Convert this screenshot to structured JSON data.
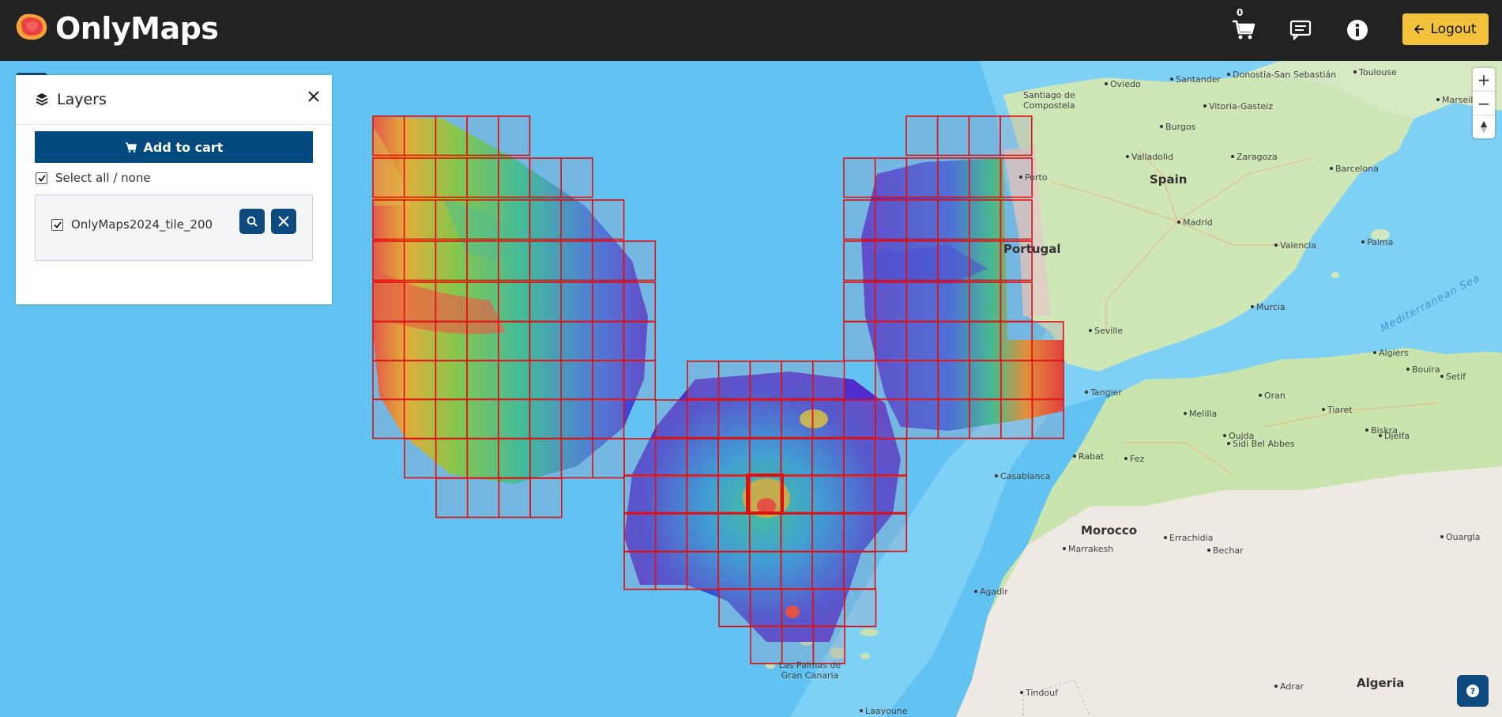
{
  "header": {
    "brand": "OnlyMaps",
    "cart_count": "0",
    "logout_label": "Logout"
  },
  "panel": {
    "title": "Layers",
    "add_to_cart_label": "Add to cart",
    "select_all_label": "Select all / none",
    "layer_name": "OnlyMaps2024_tile_200"
  },
  "map_labels": {
    "countries": [
      "Spain",
      "Portugal",
      "Morocco",
      "Algeria"
    ],
    "sea": "Mediterranean Sea",
    "places": [
      "Oviedo",
      "Santander",
      "Donostia-San Sebastián",
      "Toulouse",
      "Marseille",
      "Santiago de Compostela",
      "Vitoria-Gasteiz",
      "Burgos",
      "Valladolid",
      "Zaragoza",
      "Barcelona",
      "Madrid",
      "Valencia",
      "Palma",
      "Murcia",
      "Seville",
      "Porto",
      "Algiers",
      "Bouira",
      "Setif",
      "Tangier",
      "Oran",
      "Melilla",
      "Sidi Bel Abbes",
      "Tiaret",
      "Oujda",
      "Biskra",
      "Djelfa",
      "Rabat",
      "Fez",
      "Casablanca",
      "Errachidia",
      "Bechar",
      "Marrakesh",
      "Agadir",
      "Ouargla",
      "Las Palmas de Gran Canaria",
      "Tindouf",
      "Adrar",
      "Laayoune"
    ]
  },
  "colors": {
    "header_bg": "#222222",
    "accent": "#004a80",
    "logout_bg": "#f3c23a",
    "grid_line": "#e01010",
    "ocean": "#62c3f2"
  },
  "icons": [
    "cart-icon",
    "message-icon",
    "info-icon",
    "arrow-left-icon",
    "layers-icon",
    "close-icon",
    "search-icon",
    "remove-icon",
    "zoom-in-icon",
    "zoom-out-icon",
    "compass-icon",
    "help-icon"
  ]
}
